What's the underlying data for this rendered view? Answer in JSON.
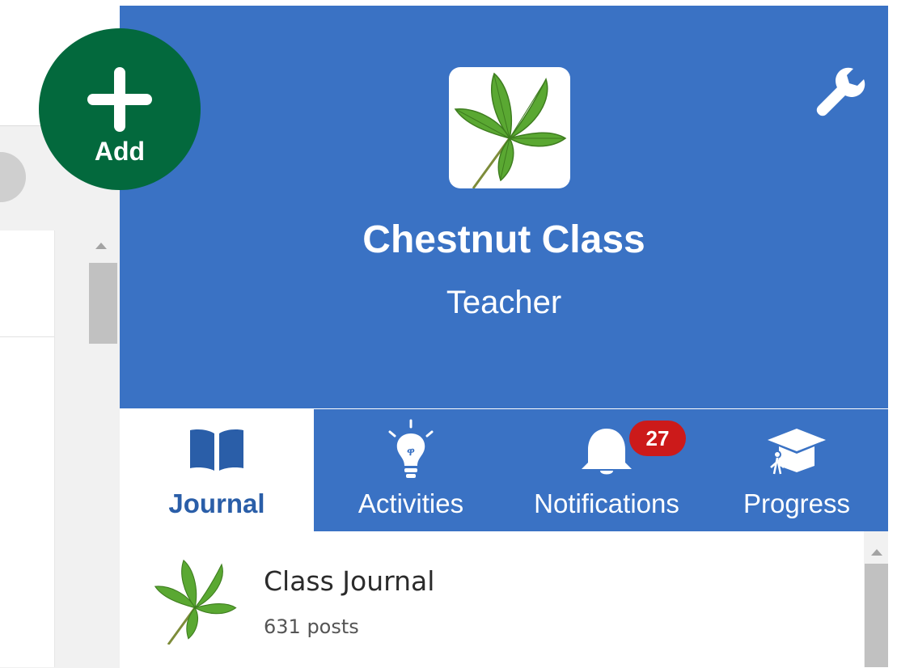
{
  "add_button": {
    "label": "Add"
  },
  "header": {
    "class_name": "Chestnut Class",
    "role": "Teacher",
    "background_color": "#3a72c4"
  },
  "tabs": [
    {
      "label": "Journal",
      "icon": "book-icon",
      "active": true
    },
    {
      "label": "Activities",
      "icon": "lightbulb-icon",
      "active": false
    },
    {
      "label": "Notifications",
      "icon": "bell-icon",
      "active": false,
      "badge": "27"
    },
    {
      "label": "Progress",
      "icon": "graduation-cap-icon",
      "active": false
    }
  ],
  "journal_list": [
    {
      "title": "Class Journal",
      "subtitle": "631 posts",
      "icon": "chestnut-leaf-icon"
    }
  ],
  "colors": {
    "add_button": "#03693d",
    "badge": "#cc1a1a",
    "active_tab_text": "#2a5ea8"
  }
}
